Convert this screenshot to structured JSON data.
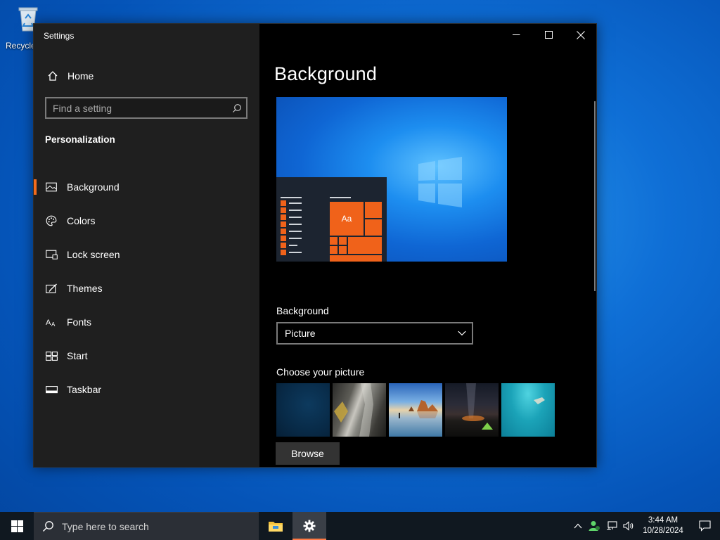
{
  "desktop": {
    "recycle_bin_label": "Recycle Bin"
  },
  "window": {
    "title": "Settings",
    "controls": {
      "minimize": "minimize",
      "maximize": "maximize",
      "close": "close"
    }
  },
  "sidebar": {
    "home_label": "Home",
    "search_placeholder": "Find a setting",
    "section_heading": "Personalization",
    "items": [
      {
        "label": "Background",
        "icon": "picture-icon",
        "selected": true
      },
      {
        "label": "Colors",
        "icon": "palette-icon",
        "selected": false
      },
      {
        "label": "Lock screen",
        "icon": "lock-screen-icon",
        "selected": false
      },
      {
        "label": "Themes",
        "icon": "themes-icon",
        "selected": false
      },
      {
        "label": "Fonts",
        "icon": "fonts-icon",
        "selected": false
      },
      {
        "label": "Start",
        "icon": "start-icon",
        "selected": false
      },
      {
        "label": "Taskbar",
        "icon": "taskbar-icon",
        "selected": false
      }
    ],
    "accent_color": "#f26b1d"
  },
  "main": {
    "page_title": "Background",
    "preview": {
      "tile_text": "Aa",
      "tile_color": "#f0621a"
    },
    "background_label": "Background",
    "background_value": "Picture",
    "choose_label": "Choose your picture",
    "thumbnails": [
      "dark-blue-picture",
      "rock-wall-picture",
      "beach-rocks-picture",
      "night-sky-tent-picture",
      "underwater-swimmer-picture"
    ],
    "browse_label": "Browse"
  },
  "taskbar": {
    "search_placeholder": "Type here to search",
    "apps": [
      "file-explorer-icon",
      "settings-gear-icon"
    ],
    "time": "3:44 AM",
    "date": "10/28/2024",
    "accent_color": "#ff7a45"
  }
}
